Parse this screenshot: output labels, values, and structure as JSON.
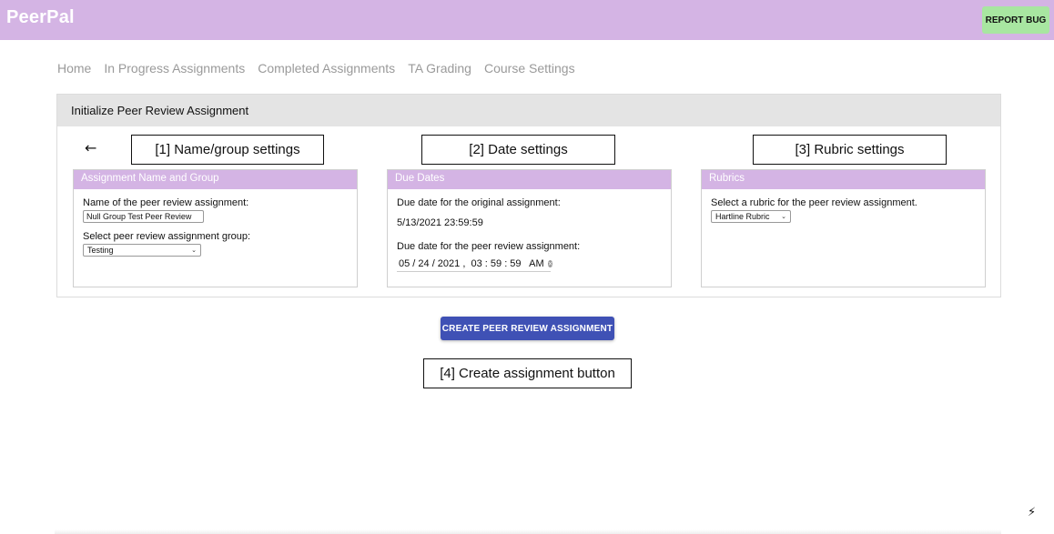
{
  "app": {
    "brand": "PeerPal",
    "report_bug": "REPORT BUG"
  },
  "nav": [
    "Home",
    "In Progress Assignments",
    "Completed Assignments",
    "TA Grading",
    "Course Settings"
  ],
  "panel": {
    "title": "Initialize Peer Review Assignment",
    "back_icon": "arrow-left-icon"
  },
  "callouts": {
    "name_group": "[1] Name/group settings",
    "dates": "[2] Date settings",
    "rubric": "[3] Rubric settings",
    "create": "[4] Create assignment button"
  },
  "name_card": {
    "header": "Assignment Name and Group",
    "name_label": "Name of the peer review assignment:",
    "name_value": "Null Group Test Peer Review",
    "group_label": "Select peer review assignment group:",
    "group_value": "Testing"
  },
  "date_card": {
    "header": "Due Dates",
    "original_label": "Due date for the original assignment:",
    "original_value": "5/13/2021 23:59:59",
    "peer_label": "Due date for the peer review assignment:",
    "peer_value": "05 / 24 / 2021 ,  03 : 59 : 59   AM"
  },
  "rubric_card": {
    "header": "Rubrics",
    "label": "Select a rubric for the peer review assignment.",
    "value": "Hartline Rubric"
  },
  "create_button": "CREATE PEER REVIEW ASSIGNMENT",
  "colors": {
    "header_purple": "#d4b4e4",
    "report_green": "#a8e6a1",
    "primary_blue": "#3f51b5"
  }
}
